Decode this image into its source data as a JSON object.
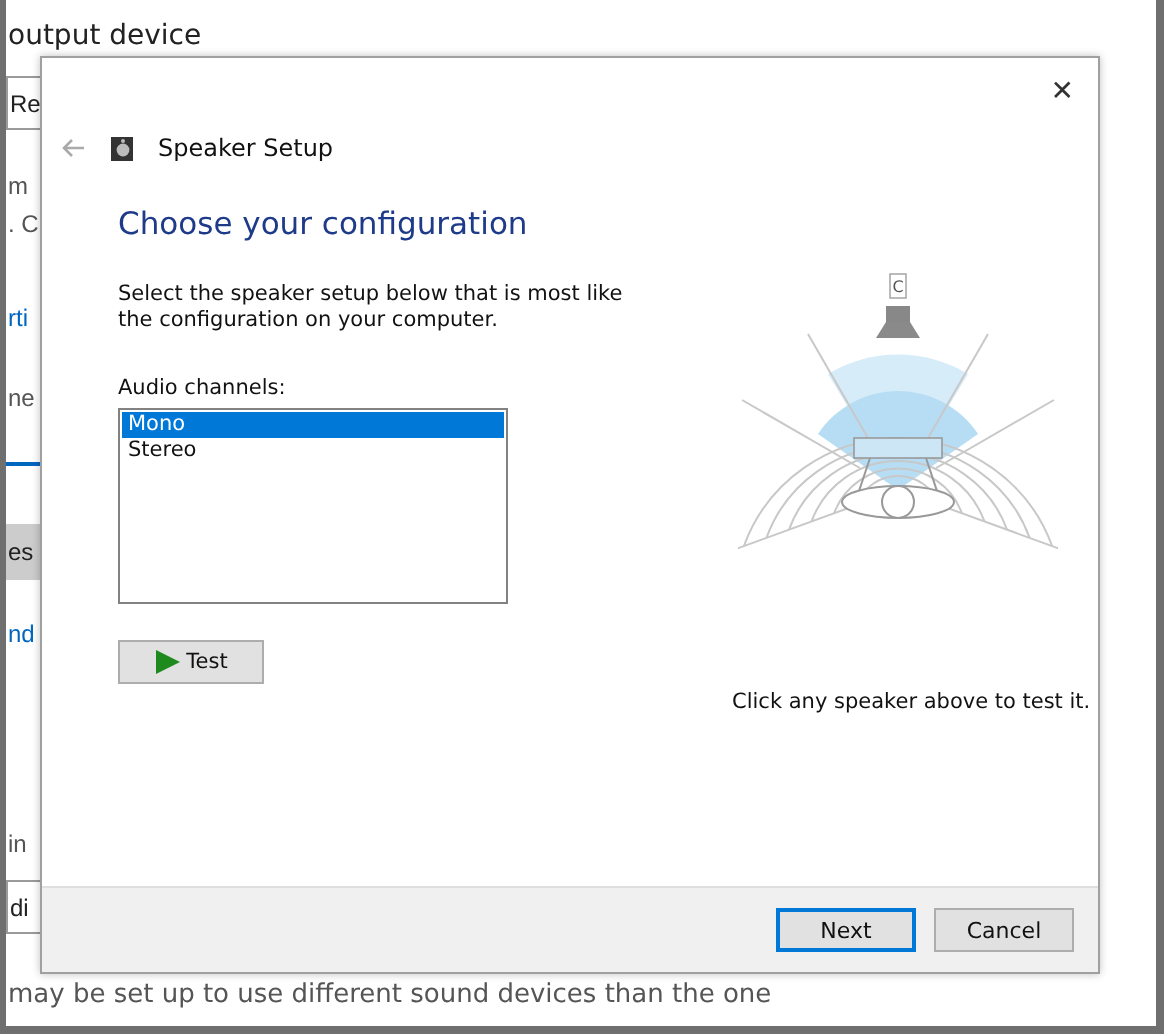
{
  "background": {
    "items": [
      {
        "kind": "title",
        "text": "output device"
      },
      {
        "kind": "field",
        "text": "Re"
      },
      {
        "kind": "text",
        "text": "m"
      },
      {
        "kind": "text",
        "text": ". C"
      },
      {
        "kind": "link",
        "text": "rti"
      },
      {
        "kind": "text",
        "text": "ne"
      },
      {
        "kind": "rule"
      },
      {
        "kind": "button",
        "text": "es"
      },
      {
        "kind": "link",
        "text": "nd"
      },
      {
        "kind": "text",
        "text": "in"
      },
      {
        "kind": "field",
        "text": "di"
      },
      {
        "kind": "text",
        "text": "may be set up to use different sound devices than the one"
      }
    ]
  },
  "dialog": {
    "title": "Speaker Setup",
    "close": "✕",
    "heading": "Choose your configuration",
    "description": "Select the speaker setup below that is most like the configuration on your computer.",
    "list_label": "Audio channels:",
    "channels": [
      {
        "label": "Mono",
        "selected": true
      },
      {
        "label": "Stereo",
        "selected": false
      }
    ],
    "test_button": "Test",
    "speaker_label": "C",
    "hint": "Click any speaker above to test it.",
    "buttons": [
      {
        "label": "Next",
        "default": true
      },
      {
        "label": "Cancel",
        "default": false
      }
    ]
  }
}
